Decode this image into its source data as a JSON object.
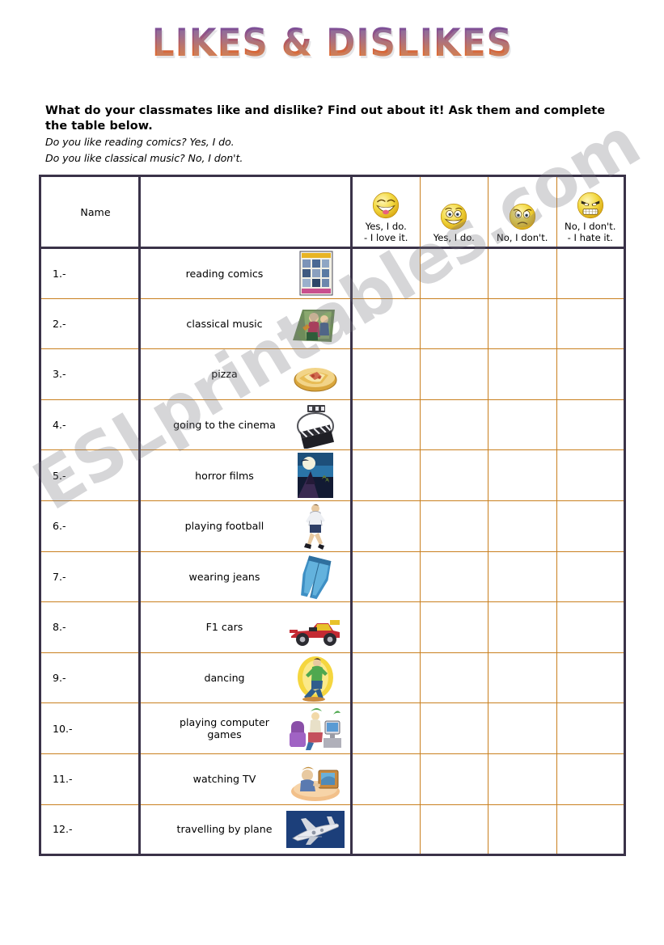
{
  "title": "LIKES & DISLIKES",
  "instructions": {
    "main": "What do your classmates like and dislike?  Find out about it!  Ask them and complete the table below.",
    "example_1": "Do you like reading comics?  Yes, I do.",
    "example_2": "Do you like classical music?  No, I don't."
  },
  "watermark": "ESLprintables.com",
  "table": {
    "name_header": "Name",
    "answer_headers": [
      {
        "face": "laughing-face",
        "label": "Yes, I do.\n- I love it."
      },
      {
        "face": "grinning-face",
        "label": "Yes, I do."
      },
      {
        "face": "sad-face",
        "label": "No, I don't."
      },
      {
        "face": "angry-face",
        "label": "No, I don't.\n- I hate it."
      }
    ],
    "rows": [
      {
        "number": "1.-",
        "activity": "reading comics",
        "picture": "comic-book"
      },
      {
        "number": "2.-",
        "activity": "classical music",
        "picture": "musicians"
      },
      {
        "number": "3.-",
        "activity": "pizza",
        "picture": "pizza"
      },
      {
        "number": "4.-",
        "activity": "going to the cinema",
        "picture": "film-clapper"
      },
      {
        "number": "5.-",
        "activity": "horror films",
        "picture": "horror-poster"
      },
      {
        "number": "6.-",
        "activity": "playing football",
        "picture": "footballer"
      },
      {
        "number": "7.-",
        "activity": "wearing jeans",
        "picture": "jeans"
      },
      {
        "number": "8.-",
        "activity": "F1 cars",
        "picture": "race-car"
      },
      {
        "number": "9.-",
        "activity": "dancing",
        "picture": "dancer"
      },
      {
        "number": "10.-",
        "activity": "playing computer games",
        "picture": "computer-gamer"
      },
      {
        "number": "11.-",
        "activity": "watching TV",
        "picture": "tv-watcher"
      },
      {
        "number": "12.-",
        "activity": "travelling by plane",
        "picture": "airplane"
      }
    ]
  },
  "colors": {
    "frame": "#3a3248",
    "grid": "#c9801f",
    "title_top": "#6b4fa0",
    "title_bottom": "#e4702a"
  }
}
